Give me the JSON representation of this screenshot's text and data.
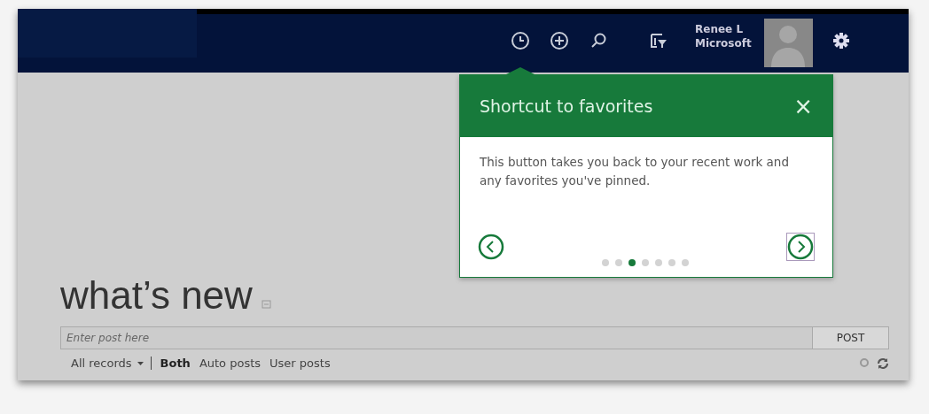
{
  "header": {
    "user_name": "Renee L",
    "user_org": "Microsoft"
  },
  "tip": {
    "title": "Shortcut to favorites",
    "close": "×",
    "body": "This button takes you back to your recent work and any favorites you've pinned.",
    "dots": [
      {
        "selected": false
      },
      {
        "selected": false
      },
      {
        "selected": true
      },
      {
        "selected": false
      },
      {
        "selected": false
      },
      {
        "selected": false
      },
      {
        "selected": false
      }
    ]
  },
  "page": {
    "title": "what’s new",
    "post_field": {
      "placeholder": "Enter post here"
    },
    "post_button": "POST",
    "filter": "All records",
    "tabs": [
      {
        "label": "Both",
        "selected": true
      },
      {
        "label": "Auto posts",
        "selected": false
      },
      {
        "label": "User posts",
        "selected": false
      }
    ]
  }
}
